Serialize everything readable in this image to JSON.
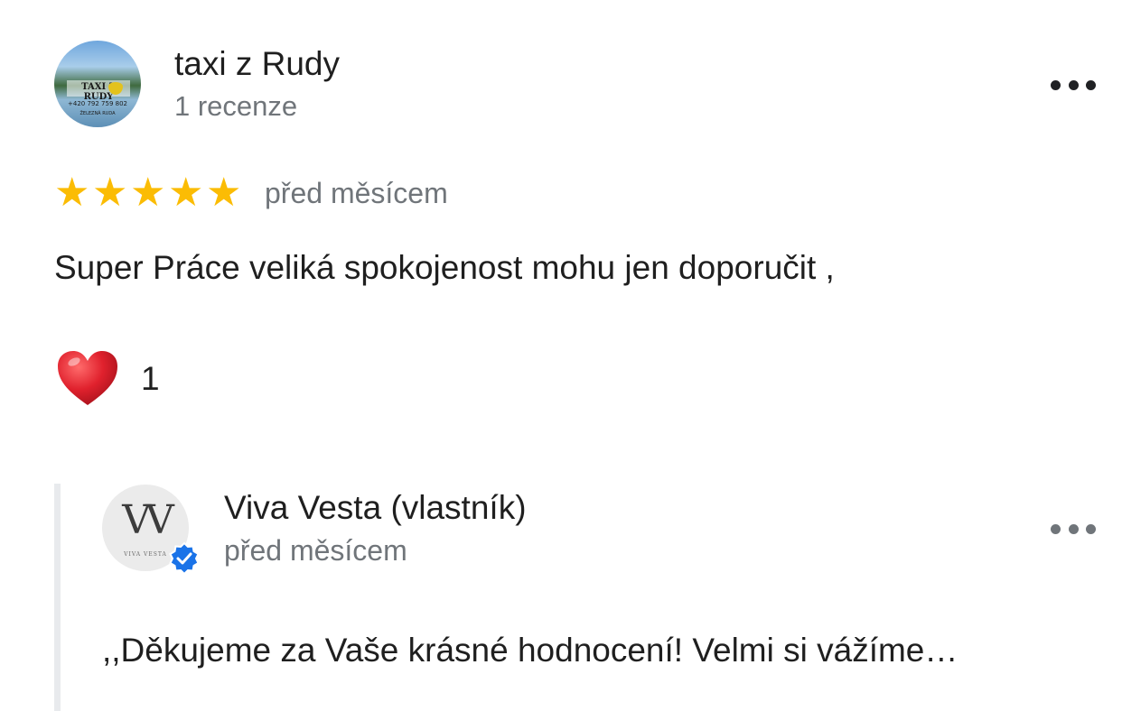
{
  "review": {
    "author": {
      "name": "taxi z Rudy",
      "meta": "1 recenze",
      "avatar_sign": "TAXI Z RUDY",
      "avatar_phone": "+420 792 759 802",
      "avatar_place": "ŽELEZNÁ RUDA"
    },
    "rating": 5,
    "stars": [
      "★",
      "★",
      "★",
      "★",
      "★"
    ],
    "date": "před měsícem",
    "text": "Super Práce veliká spokojenost mohu jen doporučit ,",
    "reaction": {
      "icon": "heart-icon",
      "count": "1"
    },
    "more_icon": "more-horizontal-icon"
  },
  "owner_reply": {
    "name": "Viva Vesta (vlastník)",
    "date": "před měsícem",
    "text": ",,Děkujeme za Vaše krásné hodnocení! Velmi si vážíme…",
    "logo": "VV",
    "logo_sub": "VIVA VESTA",
    "verified_icon": "verified-badge-icon",
    "more_icon": "more-horizontal-icon"
  },
  "colors": {
    "star": "#fbbc04",
    "secondary_text": "#70757a",
    "primary_text": "#1f1f1f",
    "verified": "#1a73e8",
    "heart": "#e0212d",
    "reply_bar": "#e8eaed"
  }
}
